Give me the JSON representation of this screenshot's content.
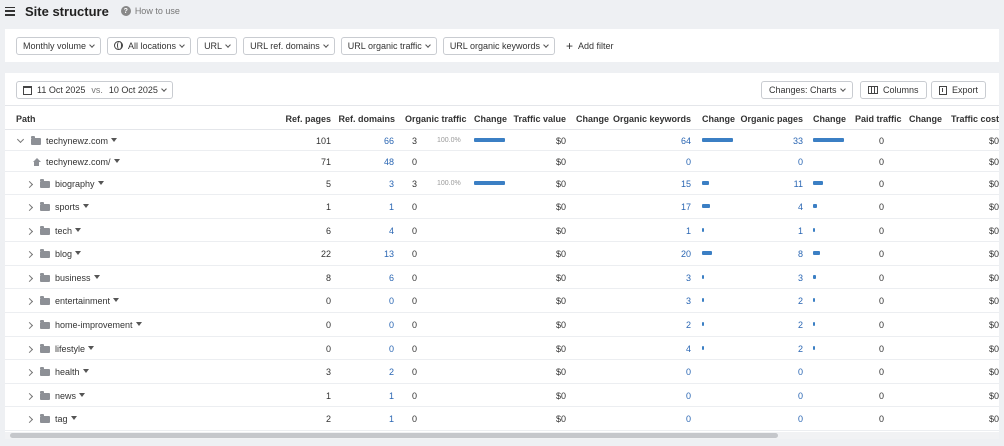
{
  "header": {
    "title": "Site structure",
    "howto": "How to use"
  },
  "filters": [
    {
      "label": "Monthly volume",
      "icon": ""
    },
    {
      "label": "All locations",
      "icon": "globe-icon"
    },
    {
      "label": "URL",
      "icon": ""
    },
    {
      "label": "URL ref. domains",
      "icon": ""
    },
    {
      "label": "URL organic traffic",
      "icon": ""
    },
    {
      "label": "URL organic keywords",
      "icon": ""
    }
  ],
  "add_filter": "Add filter",
  "toolbar": {
    "date_from": "11 Oct 2025",
    "vs": "vs.",
    "date_to": "10 Oct 2025",
    "changes": "Changes: Charts",
    "columns": "Columns",
    "export": "Export"
  },
  "columns": [
    "Path",
    "Ref. pages",
    "Ref. domains",
    "Organic traffic",
    "Change",
    "Traffic value",
    "Change",
    "Organic keywords",
    "Change",
    "Organic pages",
    "Change",
    "Paid traffic",
    "Change",
    "Traffic cost"
  ],
  "rows": [
    {
      "path": "techynewz.com",
      "kind": "root",
      "ref_pages": "101",
      "ref_domains": "66",
      "traffic": "3",
      "traffic_pct": "100.0%",
      "traffic_bar": 1.0,
      "value": "$0",
      "keywords": "64",
      "kw_bar": 1.0,
      "pages": "33",
      "pg_bar": 1.0,
      "paid": "0",
      "cost": "$0"
    },
    {
      "path": "techynewz.com/",
      "kind": "home",
      "ref_pages": "71",
      "ref_domains": "48",
      "traffic": "0",
      "traffic_pct": "",
      "traffic_bar": 0,
      "value": "$0",
      "keywords": "0",
      "kw_bar": 0,
      "pages": "0",
      "pg_bar": 0,
      "paid": "0",
      "cost": "$0"
    },
    {
      "path": "biography",
      "kind": "folder",
      "ref_pages": "5",
      "ref_domains": "3",
      "traffic": "3",
      "traffic_pct": "100.0%",
      "traffic_bar": 1.0,
      "value": "$0",
      "keywords": "15",
      "kw_bar": 0.23,
      "pages": "11",
      "pg_bar": 0.33,
      "paid": "0",
      "cost": "$0"
    },
    {
      "path": "sports",
      "kind": "folder",
      "ref_pages": "1",
      "ref_domains": "1",
      "traffic": "0",
      "traffic_pct": "",
      "traffic_bar": 0,
      "value": "$0",
      "keywords": "17",
      "kw_bar": 0.27,
      "pages": "4",
      "pg_bar": 0.12,
      "paid": "0",
      "cost": "$0"
    },
    {
      "path": "tech",
      "kind": "folder",
      "ref_pages": "6",
      "ref_domains": "4",
      "traffic": "0",
      "traffic_pct": "",
      "traffic_bar": 0,
      "value": "$0",
      "keywords": "1",
      "kw_bar": 0.02,
      "pages": "1",
      "pg_bar": 0.03,
      "paid": "0",
      "cost": "$0"
    },
    {
      "path": "blog",
      "kind": "folder",
      "ref_pages": "22",
      "ref_domains": "13",
      "traffic": "0",
      "traffic_pct": "",
      "traffic_bar": 0,
      "value": "$0",
      "keywords": "20",
      "kw_bar": 0.31,
      "pages": "8",
      "pg_bar": 0.24,
      "paid": "0",
      "cost": "$0"
    },
    {
      "path": "business",
      "kind": "folder",
      "ref_pages": "8",
      "ref_domains": "6",
      "traffic": "0",
      "traffic_pct": "",
      "traffic_bar": 0,
      "value": "$0",
      "keywords": "3",
      "kw_bar": 0.05,
      "pages": "3",
      "pg_bar": 0.09,
      "paid": "0",
      "cost": "$0"
    },
    {
      "path": "entertainment",
      "kind": "folder",
      "ref_pages": "0",
      "ref_domains": "0",
      "traffic": "0",
      "traffic_pct": "",
      "traffic_bar": 0,
      "value": "$0",
      "keywords": "3",
      "kw_bar": 0.05,
      "pages": "2",
      "pg_bar": 0.06,
      "paid": "0",
      "cost": "$0"
    },
    {
      "path": "home-improvement",
      "kind": "folder",
      "ref_pages": "0",
      "ref_domains": "0",
      "traffic": "0",
      "traffic_pct": "",
      "traffic_bar": 0,
      "value": "$0",
      "keywords": "2",
      "kw_bar": 0.03,
      "pages": "2",
      "pg_bar": 0.06,
      "paid": "0",
      "cost": "$0"
    },
    {
      "path": "lifestyle",
      "kind": "folder",
      "ref_pages": "0",
      "ref_domains": "0",
      "traffic": "0",
      "traffic_pct": "",
      "traffic_bar": 0,
      "value": "$0",
      "keywords": "4",
      "kw_bar": 0.06,
      "pages": "2",
      "pg_bar": 0.06,
      "paid": "0",
      "cost": "$0"
    },
    {
      "path": "health",
      "kind": "folder",
      "ref_pages": "3",
      "ref_domains": "2",
      "traffic": "0",
      "traffic_pct": "",
      "traffic_bar": 0,
      "value": "$0",
      "keywords": "0",
      "kw_bar": 0,
      "pages": "0",
      "pg_bar": 0,
      "paid": "0",
      "cost": "$0"
    },
    {
      "path": "news",
      "kind": "folder",
      "ref_pages": "1",
      "ref_domains": "1",
      "traffic": "0",
      "traffic_pct": "",
      "traffic_bar": 0,
      "value": "$0",
      "keywords": "0",
      "kw_bar": 0,
      "pages": "0",
      "pg_bar": 0,
      "paid": "0",
      "cost": "$0"
    },
    {
      "path": "tag",
      "kind": "folder",
      "ref_pages": "2",
      "ref_domains": "1",
      "traffic": "0",
      "traffic_pct": "",
      "traffic_bar": 0,
      "value": "$0",
      "keywords": "0",
      "kw_bar": 0,
      "pages": "0",
      "pg_bar": 0,
      "paid": "0",
      "cost": "$0"
    }
  ],
  "colors": {
    "accent": "#3b7fc4",
    "link": "#2a66b3"
  }
}
